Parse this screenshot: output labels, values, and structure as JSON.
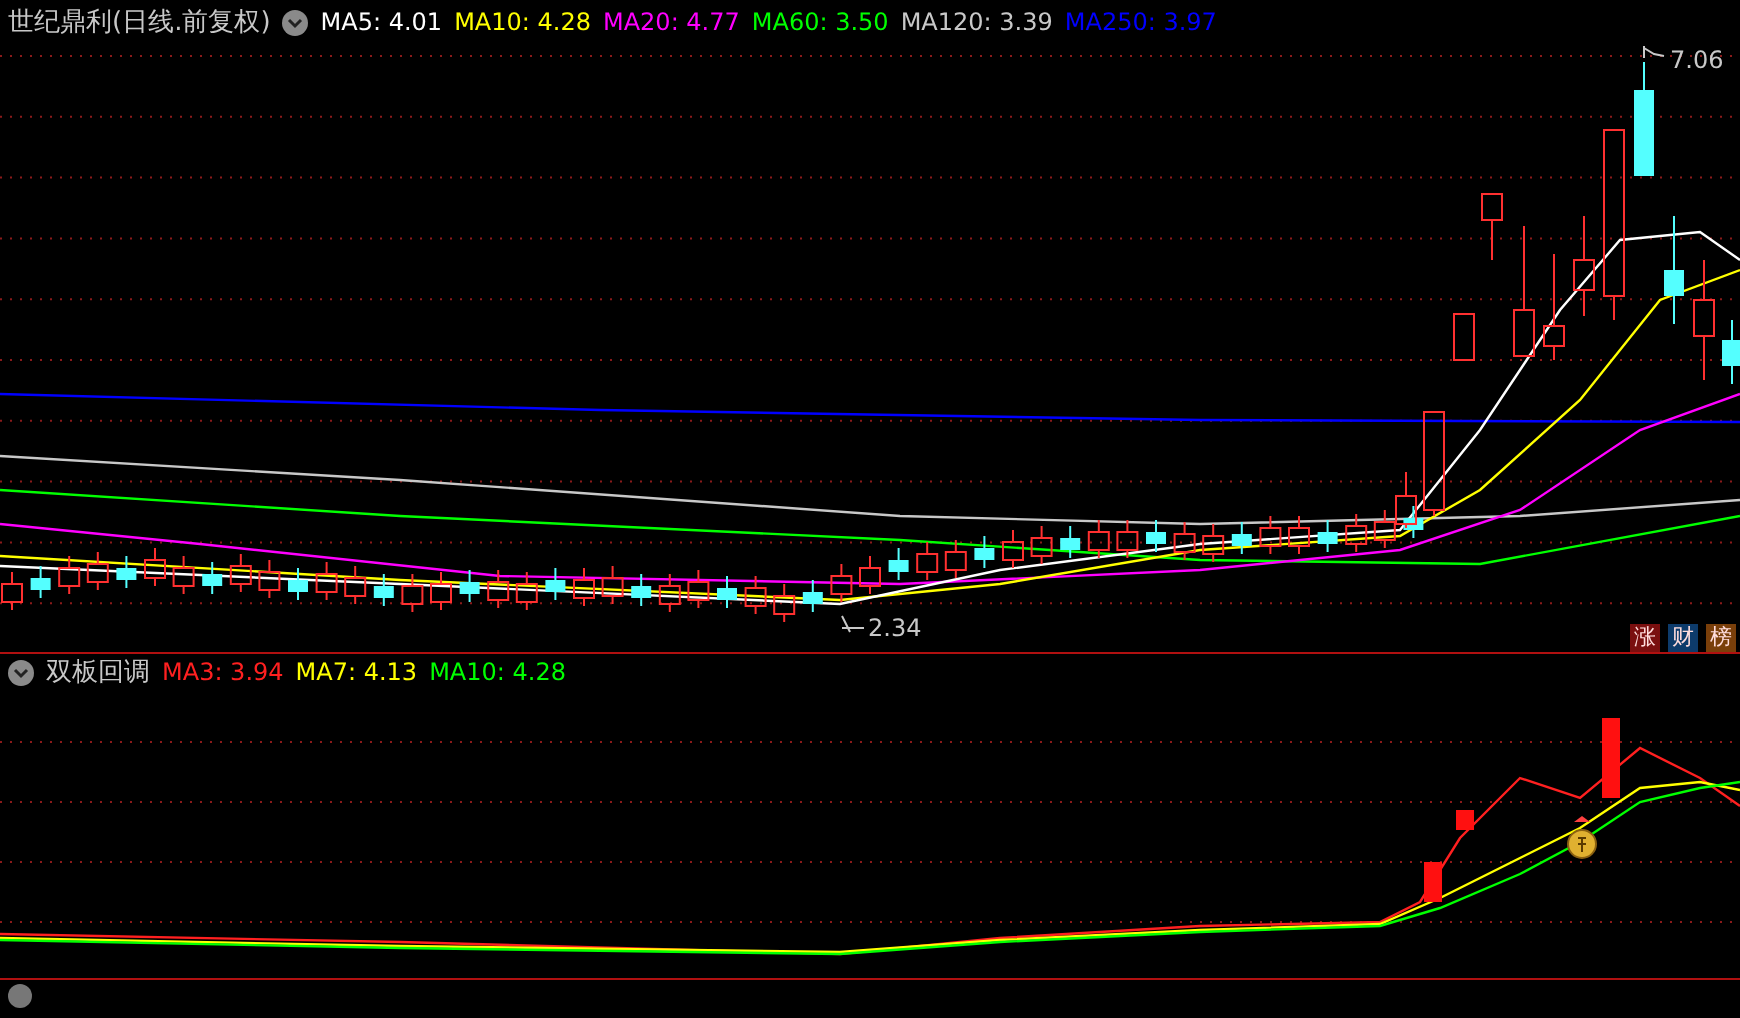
{
  "main_panel": {
    "title": "世纪鼎利(日线.前复权)",
    "indicators": [
      {
        "label": "MA5: 4.01",
        "color": "#ffffff"
      },
      {
        "label": "MA10: 4.28",
        "color": "#ffff00"
      },
      {
        "label": "MA20: 4.77",
        "color": "#ff00ff"
      },
      {
        "label": "MA60: 3.50",
        "color": "#00ff00"
      },
      {
        "label": "MA120: 3.39",
        "color": "#c8c8c8"
      },
      {
        "label": "MA250: 3.97",
        "color": "#0000ff"
      }
    ],
    "high_label": "7.06",
    "low_label": "2.34",
    "badges": [
      {
        "text": "涨",
        "color": "#7a0f0f"
      },
      {
        "text": "财",
        "color": "#0d3b6b"
      },
      {
        "text": "榜",
        "color": "#7a3f0a"
      }
    ]
  },
  "sub_panel": {
    "title": "双板回调",
    "indicators": [
      {
        "label": "MA3: 3.94",
        "color": "#ff2020"
      },
      {
        "label": "MA7: 4.13",
        "color": "#ffff00"
      },
      {
        "label": "MA10: 4.28",
        "color": "#00ff00"
      }
    ]
  }
}
